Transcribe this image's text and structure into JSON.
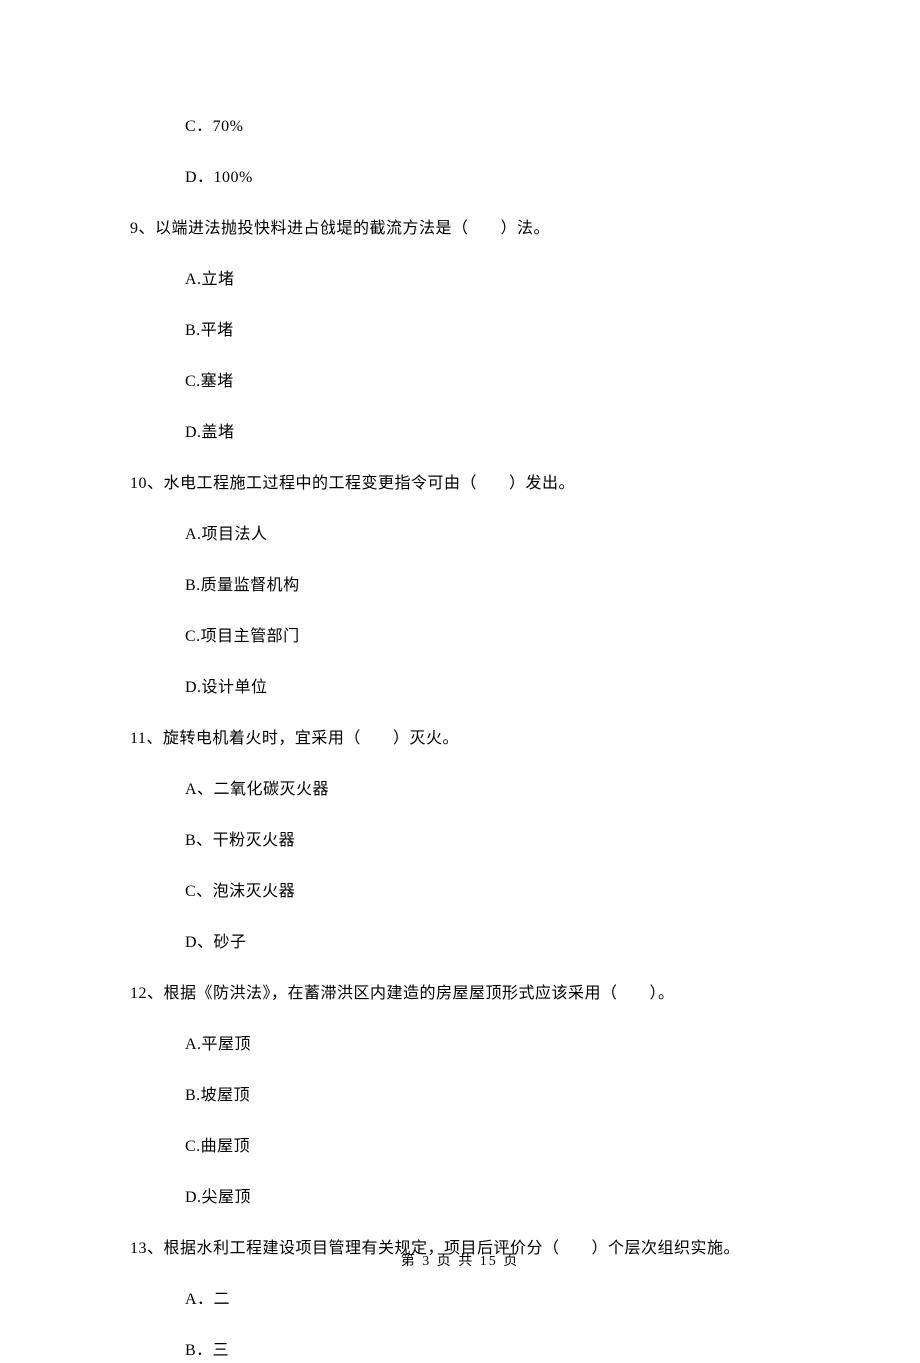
{
  "q8": {
    "options": {
      "c": "C．70%",
      "d": "D．100%"
    }
  },
  "q9": {
    "stem_pre": "9、以端进法抛投快料进占戗堤的截流方法是（",
    "stem_post": "）法。",
    "options": {
      "a": "A.立堵",
      "b": "B.平堵",
      "c": "C.塞堵",
      "d": "D.盖堵"
    }
  },
  "q10": {
    "stem_pre": "10、水电工程施工过程中的工程变更指令可由（",
    "stem_post": "）发出。",
    "options": {
      "a": "A.项目法人",
      "b": "B.质量监督机构",
      "c": "C.项目主管部门",
      "d": "D.设计单位"
    }
  },
  "q11": {
    "stem_pre": "11、旋转电机着火时，宜采用（",
    "stem_post": "）灭火。",
    "options": {
      "a": "A、二氧化碳灭火器",
      "b": "B、干粉灭火器",
      "c": "C、泡沫灭火器",
      "d": "D、砂子"
    }
  },
  "q12": {
    "stem_pre": "12、根据《防洪法》，在蓄滞洪区内建造的房屋屋顶形式应该采用（",
    "stem_post": "）。",
    "options": {
      "a": "A.平屋顶",
      "b": "B.坡屋顶",
      "c": "C.曲屋顶",
      "d": "D.尖屋顶"
    }
  },
  "q13": {
    "stem_pre": "13、根据水利工程建设项目管理有关规定，项目后评价分（",
    "stem_post": "）个层次组织实施。",
    "options": {
      "a": "A．二",
      "b": "B．三"
    }
  },
  "footer": "第 3 页 共 15 页"
}
